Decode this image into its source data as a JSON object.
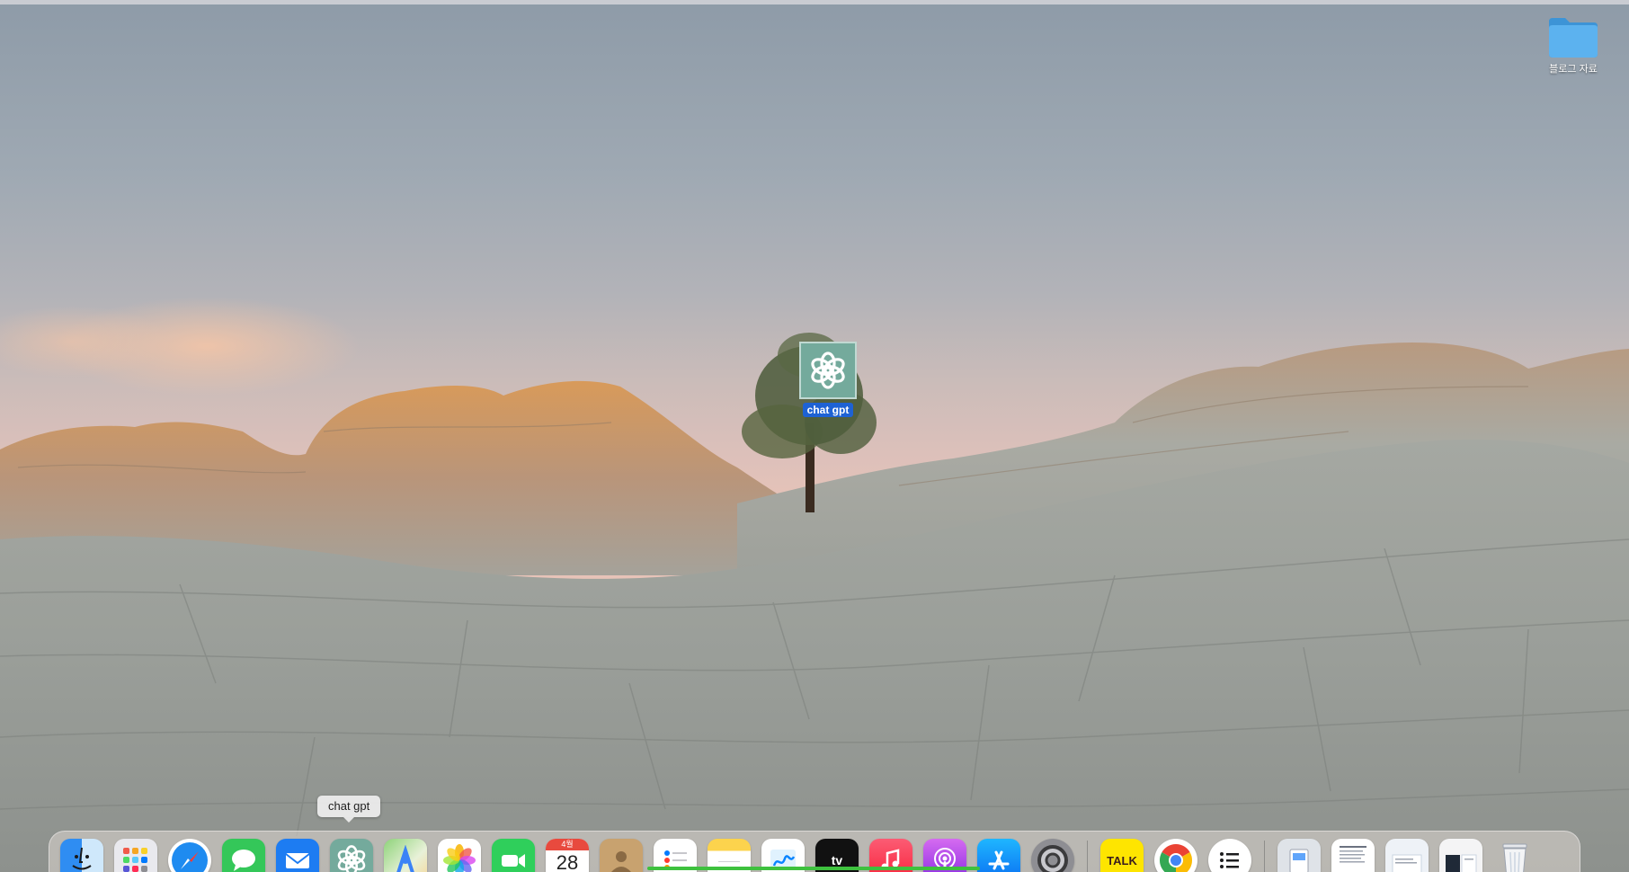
{
  "desktop": {
    "folder": {
      "label": "블로그 자료",
      "icon": "folder-icon",
      "color": "#4fa7e8"
    },
    "app_icon": {
      "label": "chat gpt",
      "icon": "chatgpt-icon",
      "tile_color": "#74aa9c",
      "selection_color": "#1e62d4"
    }
  },
  "dock": {
    "tooltip": "chat gpt",
    "apps": [
      {
        "name": "Finder",
        "icon": "finder-icon"
      },
      {
        "name": "Launchpad",
        "icon": "launchpad-icon"
      },
      {
        "name": "Safari",
        "icon": "safari-icon"
      },
      {
        "name": "Messages",
        "icon": "messages-icon"
      },
      {
        "name": "Mail",
        "icon": "mail-icon"
      },
      {
        "name": "chat gpt",
        "icon": "chatgpt-icon"
      },
      {
        "name": "Maps",
        "icon": "maps-icon"
      },
      {
        "name": "Photos",
        "icon": "photos-icon"
      },
      {
        "name": "FaceTime",
        "icon": "facetime-icon"
      },
      {
        "name": "Calendar",
        "icon": "calendar-icon",
        "month": "4월",
        "day": "28"
      },
      {
        "name": "Contacts",
        "icon": "contacts-icon"
      },
      {
        "name": "Reminders",
        "icon": "reminders-icon"
      },
      {
        "name": "Notes",
        "icon": "notes-icon"
      },
      {
        "name": "Freeform",
        "icon": "freeform-icon"
      },
      {
        "name": "TV",
        "icon": "appletv-icon",
        "text": "tv"
      },
      {
        "name": "Music",
        "icon": "music-icon"
      },
      {
        "name": "Podcasts",
        "icon": "podcasts-icon"
      },
      {
        "name": "App Store",
        "icon": "appstore-icon"
      },
      {
        "name": "System Settings",
        "icon": "settings-icon"
      },
      {
        "name": "KakaoTalk",
        "icon": "kakaotalk-icon",
        "text": "TALK"
      },
      {
        "name": "Chrome",
        "icon": "chrome-icon"
      },
      {
        "name": "Lists",
        "icon": "list-icon"
      }
    ],
    "stacks": [
      {
        "name": "Downloads",
        "icon": "downloads-stack-icon"
      },
      {
        "name": "Document 1",
        "icon": "document-thumbnail-icon"
      },
      {
        "name": "Document 2",
        "icon": "document-thumbnail-icon"
      },
      {
        "name": "Document 3",
        "icon": "document-thumbnail-icon"
      },
      {
        "name": "Trash",
        "icon": "trash-icon"
      }
    ],
    "progress_color": "#3ec13e"
  }
}
